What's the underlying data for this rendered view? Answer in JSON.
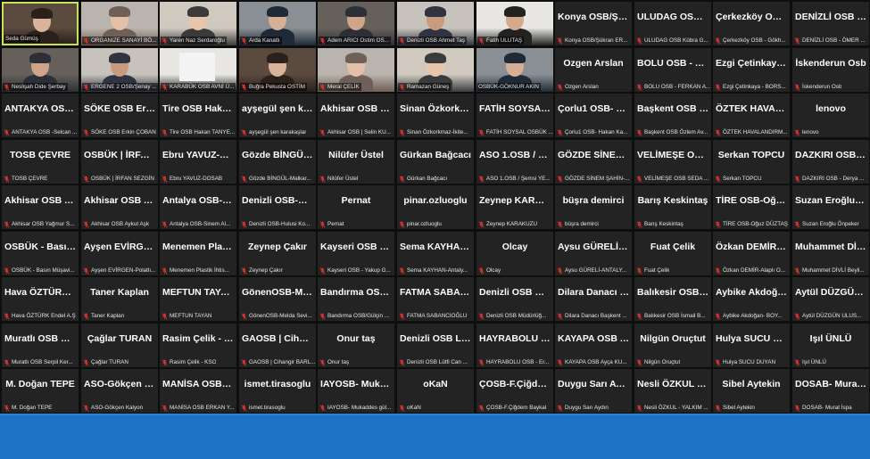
{
  "colors": {
    "tile_bg": "#232323",
    "active_border": "#c8e05a",
    "mic_muted": "#e0332e",
    "taskbar": "#1f73c7"
  },
  "icons": {
    "muted": "muted-mic-icon"
  },
  "rows": [
    [
      {
        "name": "",
        "label": "Seda Gümüş",
        "video": true,
        "active": true,
        "muted": false
      },
      {
        "name": "",
        "label": "ORGANIZE SANAYİ BÖ...",
        "video": true,
        "muted": true
      },
      {
        "name": "",
        "label": "Yaren Naz Serdaroğlu",
        "video": true,
        "muted": true
      },
      {
        "name": "",
        "label": "Arda Kanatlı",
        "video": true,
        "muted": true
      },
      {
        "name": "",
        "label": "Adem ARICI Ostim OS...",
        "video": true,
        "muted": true
      },
      {
        "name": "",
        "label": "Denizli OSB Ahmet Taş",
        "video": true,
        "muted": true
      },
      {
        "name": "",
        "label": "Fatih ULUTAŞ",
        "video": true,
        "muted": true
      },
      {
        "name": "Konya OSB/Şük...",
        "label": "Konya OSB/Şükran ER...",
        "muted": true
      },
      {
        "name": "ULUDAG OSB K...",
        "label": "ULUDAG OSB Kübra G...",
        "muted": true
      },
      {
        "name": "Çerkezköy OSB ...",
        "label": "Çerkezköy OSB - Gökh...",
        "muted": true
      },
      {
        "name": "DENİZLİ OSB -...",
        "label": "DENİZLİ OSB - ÖMER ...",
        "muted": true
      }
    ],
    [
      {
        "name": "",
        "label": "Neslişah Dide Şerbay",
        "video": true,
        "muted": true
      },
      {
        "name": "",
        "label": "ERGENE 2 OSB/Şenay ...",
        "video": true,
        "muted": true
      },
      {
        "name": "",
        "label": "KARABÜK OSB AVNİ Ü...",
        "video": true,
        "blank": true,
        "muted": true
      },
      {
        "name": "",
        "label": "Buğra Pekusta OSTİM",
        "video": true,
        "muted": true
      },
      {
        "name": "",
        "label": "Meral ÇELİK",
        "video": true,
        "muted": true
      },
      {
        "name": "",
        "label": "Ramazan Güneş",
        "video": true,
        "muted": true
      },
      {
        "name": "",
        "label": "OSBÜK-GÖKNUR AKIN",
        "video": true,
        "muted": false
      },
      {
        "name": "Ozgen Arslan",
        "label": "Ozgen Arslan",
        "muted": true
      },
      {
        "name": "BOLU OSB - FER...",
        "label": "BOLU OSB - FERKAN A...",
        "muted": true
      },
      {
        "name": "Ezgi Çetinkaya -...",
        "label": "Ezgi Çetinkaya - BORS...",
        "muted": true
      },
      {
        "name": "İskenderun Osb",
        "label": "İskenderun Osb",
        "muted": true
      }
    ],
    [
      {
        "name": "ANTAKYA OSB -...",
        "label": "ANTAKYA OSB -Selcan ...",
        "muted": true
      },
      {
        "name": "SÖKE OSB Erkin...",
        "label": "SÖKE OSB Erkin ÇOBAN",
        "muted": true
      },
      {
        "name": "Tire OSB Hakan...",
        "label": "Tire OSB Hakan TANYE...",
        "muted": true
      },
      {
        "name": "ayşegül şen kar...",
        "label": "ayşegül şen karakaşlar",
        "muted": true
      },
      {
        "name": "Akhisar OSB | S...",
        "label": "Akhisar OSB | Selin KU...",
        "muted": true
      },
      {
        "name": "Sinan Özkorkm...",
        "label": "Sinan Özkorkmaz-İkite...",
        "muted": true
      },
      {
        "name": "FATİH SOYSAL...",
        "label": "FATİH SOYSAL OSBÜK ...",
        "muted": true
      },
      {
        "name": "Çorlu1 OSB- Ha...",
        "label": "Çorlu1 OSB- Hakan Ka...",
        "muted": true
      },
      {
        "name": "Başkent OSB Öz...",
        "label": "Başkent OSB Özlem Av...",
        "muted": true
      },
      {
        "name": "ÖZTEK HAVALA...",
        "label": "ÖZTEK HAVALANDIRM...",
        "muted": true
      },
      {
        "name": "lenovo",
        "label": "lenovo",
        "muted": true
      }
    ],
    [
      {
        "name": "TOSB ÇEVRE",
        "label": "TOSB ÇEVRE",
        "muted": true
      },
      {
        "name": "OSBÜK | İRFAN...",
        "label": "OSBÜK | İRFAN SEZGİN",
        "muted": true
      },
      {
        "name": "Ebru YAVUZ-DO...",
        "label": "Ebru YAVUZ-DOSAB",
        "muted": true
      },
      {
        "name": "Gözde BİNGÜL-...",
        "label": "Gözde BİNGÜL-Malkar...",
        "muted": true
      },
      {
        "name": "Nilüfer Üstel",
        "label": "Nilüfer Üstel",
        "muted": true
      },
      {
        "name": "Gürkan Bağcacı",
        "label": "Gürkan Bağcacı",
        "muted": true
      },
      {
        "name": "ASO 1.OSB / Şe...",
        "label": "ASO 1.OSB / Şemsi YE...",
        "muted": true
      },
      {
        "name": "GÖZDE SİNEM Ş...",
        "label": "GÖZDE SİNEM ŞAHİN-...",
        "muted": true
      },
      {
        "name": "VELİMEŞE OSB...",
        "label": "VELİMEŞE OSB SEDA ...",
        "muted": true
      },
      {
        "name": "Serkan TOPCU",
        "label": "Serkan TOPCU",
        "muted": true
      },
      {
        "name": "DAZKIRI OSB -...",
        "label": "DAZKIRI OSB - Derya ...",
        "muted": true
      }
    ],
    [
      {
        "name": "Akhisar OSB Ya...",
        "label": "Akhisar OSB Yağmur S...",
        "muted": true
      },
      {
        "name": "Akhisar OSB Ay...",
        "label": "Akhisar OSB Aykut Aşk",
        "muted": true
      },
      {
        "name": "Antalya OSB-Si...",
        "label": "Antalya OSB-Sinem Al...",
        "muted": true
      },
      {
        "name": "Denizli OSB-Hul...",
        "label": "Denizli OSB-Hulusi Ko...",
        "muted": true
      },
      {
        "name": "Pernat",
        "label": "Pernat",
        "muted": true
      },
      {
        "name": "pinar.ozluoglu",
        "label": "pinar.ozluoglu",
        "muted": true
      },
      {
        "name": "Zeynep KARAK...",
        "label": "Zeynep KARAKUZU",
        "muted": true
      },
      {
        "name": "büşra demirci",
        "label": "büşra demirci",
        "muted": true
      },
      {
        "name": "Barış Keskintaş",
        "label": "Barış Keskintaş",
        "muted": true
      },
      {
        "name": "TİRE OSB-Oğuz...",
        "label": "TİRE OSB-Oğuz DÜZTAŞ",
        "muted": true
      },
      {
        "name": "Suzan Eroğlu Ö...",
        "label": "Suzan Eroğlu Önpeker",
        "muted": true
      }
    ],
    [
      {
        "name": "OSBÜK - Basın...",
        "label": "OSBÜK - Basın Müşavi...",
        "muted": true
      },
      {
        "name": "Ayşen EVİRGEN...",
        "label": "Ayşen EVİRGEN-Polatlı...",
        "muted": true
      },
      {
        "name": "Menemen Plasti...",
        "label": "Menemen Plastik İhtis...",
        "muted": true
      },
      {
        "name": "Zeynep Çakır",
        "label": "Zeynep Çakır",
        "muted": true
      },
      {
        "name": "Kayseri OSB - Y...",
        "label": "Kayseri OSB - Yakup G...",
        "muted": true
      },
      {
        "name": "Sema KAYHAN-...",
        "label": "Sema KAYHAN-Antaly...",
        "muted": true
      },
      {
        "name": "Olcay",
        "label": "Olcay",
        "muted": true
      },
      {
        "name": "Aysu GÜRELİ-A...",
        "label": "Aysu GÜRELİ-ANTALY...",
        "muted": true
      },
      {
        "name": "Fuat Çelik",
        "label": "Fuat Çelik",
        "muted": true
      },
      {
        "name": "Özkan DEMİR-A...",
        "label": "Özkan DEMİR-Alaplı O...",
        "muted": true
      },
      {
        "name": "Muhammet DİV...",
        "label": "Muhammet DİVLİ Beyli...",
        "muted": true
      }
    ],
    [
      {
        "name": "Hava ÖZTÜRK E...",
        "label": "Hava ÖZTÜRK Endel A.Ş",
        "muted": true
      },
      {
        "name": "Taner Kaplan",
        "label": "Taner Kaplan",
        "muted": true
      },
      {
        "name": "MEFTUN TAYAN",
        "label": "MEFTUN TAYAN",
        "muted": true
      },
      {
        "name": "GönenOSB-Mel...",
        "label": "GönenOSB-Melda Sevi...",
        "muted": true
      },
      {
        "name": "Bandırma OSB/...",
        "label": "Bandırma OSB/Gülçin ...",
        "muted": true
      },
      {
        "name": "FATMA SABAN...",
        "label": "FATMA SABANCIOĞLU",
        "muted": true
      },
      {
        "name": "Denizli OSB Mü...",
        "label": "Denizli OSB Müdürlüğ...",
        "muted": true
      },
      {
        "name": "Dilara Danacı B...",
        "label": "Dilara Danacı Başkent ...",
        "muted": true
      },
      {
        "name": "Balıkesir OSB İs...",
        "label": "Balıkesir OSB İsmail B...",
        "muted": true
      },
      {
        "name": "Aybike Akdoğa...",
        "label": "Aybike Akdoğan- BOY...",
        "muted": true
      },
      {
        "name": "Aytül DÜZGÜN...",
        "label": "Aytül DÜZGÜN ULUS...",
        "muted": true
      }
    ],
    [
      {
        "name": "Muratlı OSB Ser...",
        "label": "Muratlı OSB Serpil Ker...",
        "muted": true
      },
      {
        "name": "Çağlar TURAN",
        "label": "Çağlar TURAN",
        "muted": true
      },
      {
        "name": "Rasim Çelik - KSO",
        "label": "Rasim Çelik - KSO",
        "muted": true
      },
      {
        "name": "GAOSB | Cihang...",
        "label": "GAOSB | Cihangir BARL...",
        "muted": true
      },
      {
        "name": "Onur taş",
        "label": "Onur taş",
        "muted": true
      },
      {
        "name": "Denizli OSB Lüt...",
        "label": "Denizli OSB Lütfi Can ...",
        "muted": true
      },
      {
        "name": "HAYRABOLU OS...",
        "label": "HAYRABOLU OSB - Er...",
        "muted": true
      },
      {
        "name": "KAYAPA OSB Ay...",
        "label": "KAYAPA OSB Ayça KU...",
        "muted": true
      },
      {
        "name": "Nilgün Oruçtut",
        "label": "Nilgün Oruçtut",
        "muted": true
      },
      {
        "name": "Hulya SUCU DU...",
        "label": "Hulya SUCU DUYAN",
        "muted": true
      },
      {
        "name": "Işıl ÜNLÜ",
        "label": "Işıl ÜNLÜ",
        "muted": true
      }
    ],
    [
      {
        "name": "M. Doğan TEPE",
        "label": "M. Doğan TEPE",
        "muted": true
      },
      {
        "name": "ASO-Gökçen Ka...",
        "label": "ASO-Gökçen Kalyon",
        "muted": true
      },
      {
        "name": "MANİSA OSB E...",
        "label": "MANİSA OSB ERKAN Y...",
        "muted": true
      },
      {
        "name": "ismet.tirasoglu",
        "label": "ismet.tirasoglu",
        "muted": true
      },
      {
        "name": "IAYOSB- Mukad...",
        "label": "IAYOSB- Mukaddes gül...",
        "muted": true
      },
      {
        "name": "oKaN",
        "label": "oKaN",
        "muted": true
      },
      {
        "name": "ÇOSB-F.Çiğdem...",
        "label": "ÇOSB-F.Çiğdem Baykal",
        "muted": true
      },
      {
        "name": "Duygu Sarı Aydın",
        "label": "Duygu Sarı Aydın",
        "muted": true
      },
      {
        "name": "Nesli ÖZKUL - Y...",
        "label": "Nesli ÖZKUL - YALKIM ...",
        "muted": true
      },
      {
        "name": "Sibel Aytekin",
        "label": "Sibel Aytekin",
        "muted": true
      },
      {
        "name": "DOSAB- Murat İ...",
        "label": "DOSAB- Murat İspa",
        "muted": true
      }
    ]
  ]
}
